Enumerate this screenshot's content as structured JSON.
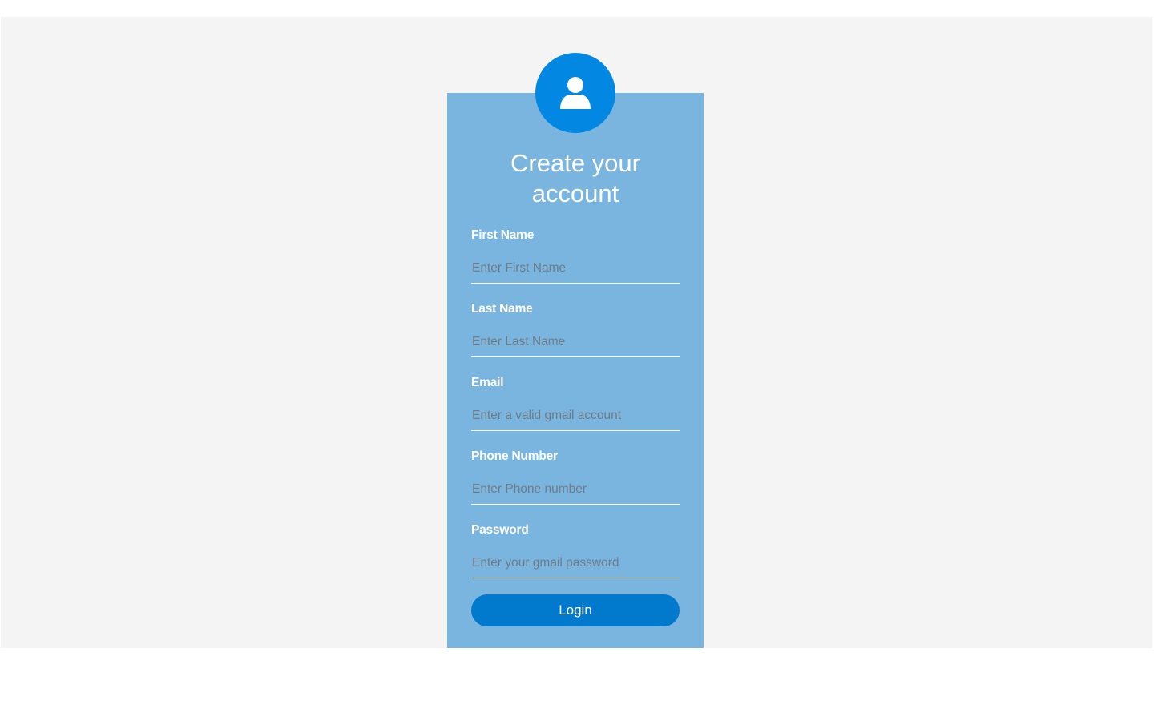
{
  "form": {
    "title_line1": "Create your",
    "title_line2": "account",
    "avatar_icon": "user-icon",
    "fields": [
      {
        "label": "First Name",
        "placeholder": "Enter First Name",
        "value": ""
      },
      {
        "label": "Last Name",
        "placeholder": "Enter Last Name",
        "value": ""
      },
      {
        "label": "Email",
        "placeholder": "Enter a valid gmail account",
        "value": ""
      },
      {
        "label": "Phone Number",
        "placeholder": "Enter Phone number",
        "value": ""
      },
      {
        "label": "Password",
        "placeholder": "Enter your gmail password",
        "value": ""
      }
    ],
    "submit_label": "Login"
  },
  "colors": {
    "page_background": "#f4f4f4",
    "card_background": "#7ab5df",
    "avatar_background": "#0288e3",
    "button_background": "#0179cc",
    "text": "#ffffff"
  }
}
